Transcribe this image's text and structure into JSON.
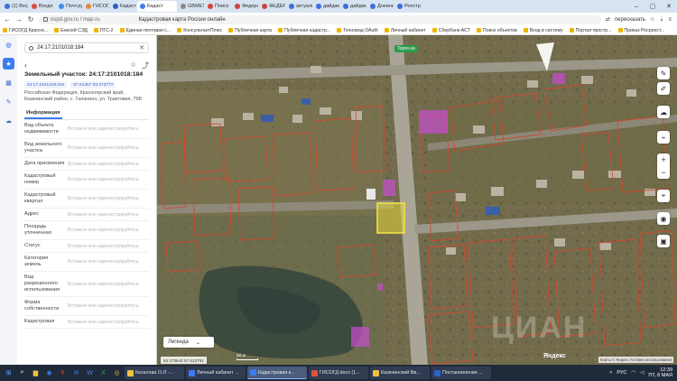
{
  "browser": {
    "tabs": [
      {
        "label": "(1) Входя",
        "color": "#3d6de0"
      },
      {
        "label": "Входя",
        "color": "#d54b3d"
      },
      {
        "label": "Почт.ру",
        "color": "#3d8ee0"
      },
      {
        "label": "ГИСОГД",
        "color": "#e08a3d"
      },
      {
        "label": "Кадастр",
        "color": "#2e5ec9"
      },
      {
        "label": "Кадаст",
        "color": "#3d7cf2",
        "active": true
      },
      {
        "label": "GBMETI",
        "color": "#888"
      },
      {
        "label": "Поиск",
        "color": "#d5433d"
      },
      {
        "label": "Федерал",
        "color": "#c44"
      },
      {
        "label": "ФЕДЕРАЛ",
        "color": "#c44"
      },
      {
        "label": "актуальн",
        "color": "#3d6de0"
      },
      {
        "label": "дайджест",
        "color": "#3d6de0"
      },
      {
        "label": "дайджест",
        "color": "#3d6de0"
      },
      {
        "label": "Дневник",
        "color": "#3d6de0"
      },
      {
        "label": "Реестр",
        "color": "#3d6de0"
      }
    ],
    "url": "nspd.gov.ru / map.ru",
    "page_title": "Кадастровая карта России онлайн",
    "translate_label": "пересказать",
    "bookmarks": [
      "ГИСОГД Красно...",
      "Енисей СЭД",
      "ПГС-2",
      "Единая почтовая с...",
      "КонсультантПлюс",
      "Публичная карта",
      "Публичная кадастр...",
      "Техновод ОАuth",
      "Личный кабинет",
      "Сбербанк-АСТ",
      "Поиск объектов",
      "Вход в систему",
      "Портал простр...",
      "Приказ Росреест..."
    ]
  },
  "panel": {
    "search_value": "24:17:2101018:184",
    "card_title": "Земельный участок: 24:17:2101018:184",
    "chip_number": "24:17:2101018:184",
    "chip_coords": "57.61357  93.273777",
    "address": "Российская Федерация, Красноярский край, Казачинский район, с. Галанино, ул. Трактовая, 79В",
    "tab_label": "Информация",
    "props": [
      {
        "k": "Вид объекта недвижимости",
        "v": "Вставьте или зарегистрируйтесь"
      },
      {
        "k": "Вид земельного участка",
        "v": "Вставьте или зарегистрируйтесь"
      },
      {
        "k": "Дата присвоения",
        "v": "Вставьте или зарегистрируйтесь"
      },
      {
        "k": "Кадастровый номер",
        "v": "Вставьте или зарегистрируйтесь"
      },
      {
        "k": "Кадастровый квартал",
        "v": "Вставьте или зарегистрируйтесь"
      },
      {
        "k": "Адрес",
        "v": "Вставьте или зарегистрируйтесь"
      },
      {
        "k": "Площадь уточненная",
        "v": "Вставьте или зарегистрируйтесь"
      },
      {
        "k": "Статус",
        "v": "Вставьте или зарегистрируйтесь"
      },
      {
        "k": "Категория земель",
        "v": "Вставьте или зарегистрируйтесь"
      },
      {
        "k": "Вид разрешенного использования",
        "v": "Вставьте или зарегистрируйтесь"
      },
      {
        "k": "Форма собственности",
        "v": "Вставьте или зарегистрируйтесь"
      },
      {
        "k": "Кадастровая",
        "v": "Вставьте или зарегистрируйтесь"
      }
    ]
  },
  "map": {
    "road_label": "Торги на",
    "legend_label": "Легенда",
    "coords_text": "93.273642  57.613791",
    "scale_label": "50 м",
    "attribution": "Карты © Яндекс  Условия использования",
    "watermark": "ЦИАН",
    "logo": "Яндекс"
  },
  "taskbar": {
    "apps": [
      {
        "label": "Каталова О.Л -...",
        "color": "#f0c040"
      },
      {
        "label": "Личный кабинет ...",
        "color": "#3d7cf2"
      },
      {
        "label": "Кадастровая к...",
        "color": "#3d7cf2",
        "active": true
      },
      {
        "label": "ГИСОГД docs (1...",
        "color": "#e05040"
      },
      {
        "label": "Казачинский Вв...",
        "color": "#f0c040"
      },
      {
        "label": "Постановление ...",
        "color": "#2e62c9"
      }
    ],
    "lang": "РУС",
    "time": "12:39",
    "date": "ПТ, 8 МАЯ"
  }
}
